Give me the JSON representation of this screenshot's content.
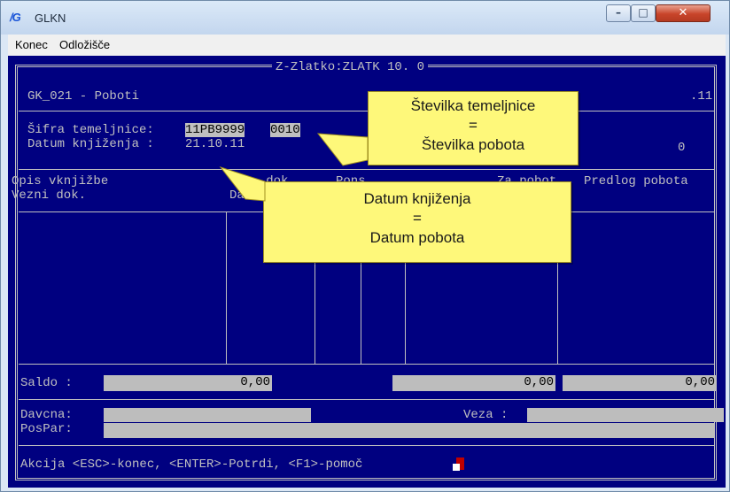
{
  "window": {
    "title": "GLKN",
    "icon_text": "/G"
  },
  "menu": [
    {
      "label": "Konec"
    },
    {
      "label": "Odložišče"
    }
  ],
  "console": {
    "frame_title": "Z-Zlatko:ZLATK 10. 0",
    "program_label": "GK_021 - Poboti",
    "date_right": ".11",
    "sifra_label": "Šifra temeljnice:",
    "sifra_value": "11PB9999",
    "sifra_num": "0010",
    "datum_label": "Datum knjiženja :",
    "datum_value": "21.10.11",
    "right_o": "0",
    "headers": {
      "opis": "Opis vknjižbe",
      "vezni": "Vezni dok.",
      "col2a": "...dok",
      "col2b": "Dat.",
      "pons": "Pons",
      "zapobot": "Za pobot",
      "predlog": "Predlog pobota"
    },
    "saldo_label": "Saldo :",
    "saldo_values": [
      "0,00",
      "0,00",
      "0,00"
    ],
    "davcna_label": "Davcna:",
    "pospar_label": "PosPar:",
    "veza_label": "Veza :",
    "status_line": "Akcija <ESC>-konec, <ENTER>-Potrdi, <F1>-pomoč"
  },
  "callouts": {
    "top": {
      "line1": "Številka temeljnice",
      "line2": "=",
      "line3": "Številka pobota"
    },
    "bottom": {
      "line1": "Datum knjiženja",
      "line2": "=",
      "line3": "Datum pobota"
    }
  },
  "colors": {
    "console_bg": "#000080",
    "console_text": "#c0c0c0",
    "field_bg": "#bdbdbd",
    "callout_bg": "#fef87a",
    "close_button": "#c8442a"
  }
}
